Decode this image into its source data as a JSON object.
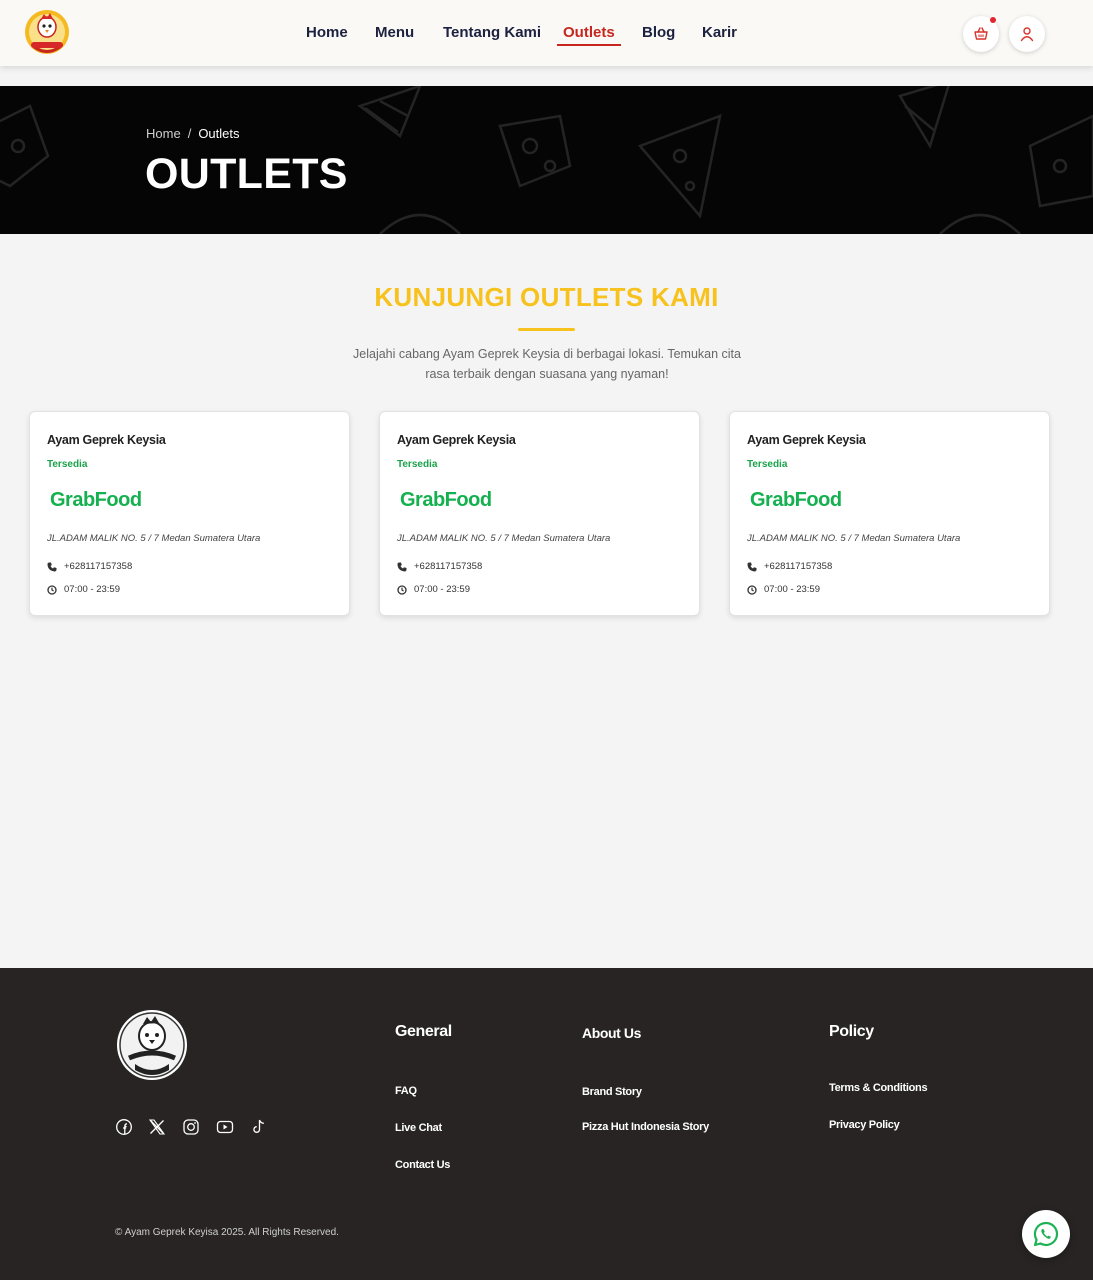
{
  "header": {
    "nav": [
      {
        "label": "Home",
        "active": false
      },
      {
        "label": "Menu",
        "active": false
      },
      {
        "label": "Tentang Kami",
        "active": false
      },
      {
        "label": "Outlets",
        "active": true
      },
      {
        "label": "Blog",
        "active": false
      },
      {
        "label": "Karir",
        "active": false
      }
    ],
    "accent_color": "#c7261e"
  },
  "hero": {
    "breadcrumb": {
      "home": "Home",
      "separator": "/",
      "current": "Outlets"
    },
    "title": "OUTLETS"
  },
  "section": {
    "title": "KUNJUNGI OUTLETS KAMI",
    "description": "Jelajahi cabang Ayam Geprek Keysia di berbagai lokasi. Temukan cita rasa terbaik dengan suasana yang nyaman!",
    "title_color": "#f7c21e"
  },
  "outlets": [
    {
      "name": "Ayam Geprek Keysia",
      "status": "Tersedia",
      "delivery": "GrabFood",
      "address": "JL.ADAM MALIK NO. 5 / 7 Medan Sumatera Utara",
      "phone": "+628117157358",
      "hours": "07:00 - 23:59"
    },
    {
      "name": "Ayam Geprek Keysia",
      "status": "Tersedia",
      "delivery": "GrabFood",
      "address": "JL.ADAM MALIK NO. 5 / 7 Medan Sumatera Utara",
      "phone": "+628117157358",
      "hours": "07:00 - 23:59"
    },
    {
      "name": "Ayam Geprek Keysia",
      "status": "Tersedia",
      "delivery": "GrabFood",
      "address": "JL.ADAM MALIK NO. 5 / 7 Medan Sumatera Utara",
      "phone": "+628117157358",
      "hours": "07:00 - 23:59"
    }
  ],
  "footer": {
    "logo_text": "Ayam Geprek Keysia",
    "socials": [
      "facebook-icon",
      "x-icon",
      "instagram-icon",
      "youtube-icon",
      "tiktok-icon"
    ],
    "columns": [
      {
        "heading": "General",
        "links": [
          "FAQ",
          "Live Chat",
          "Contact Us"
        ]
      },
      {
        "heading": "About Us",
        "links": [
          "Brand Story",
          "Pizza Hut Indonesia Story"
        ]
      },
      {
        "heading": "Policy",
        "links": [
          "Terms & Conditions",
          "Privacy Policy"
        ]
      }
    ],
    "copyright": "© Ayam Geprek Keyisa 2025. All Rights Reserved."
  },
  "whatsapp_icon": "whatsapp-icon"
}
